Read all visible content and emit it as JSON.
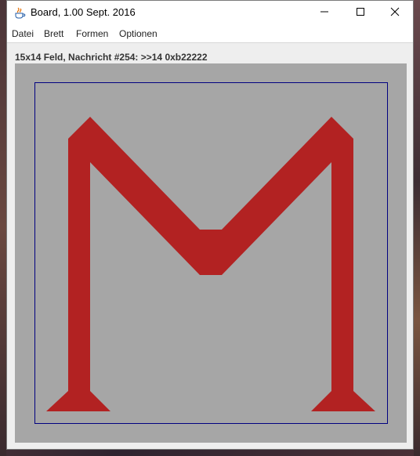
{
  "window": {
    "title": "Board, 1.00 Sept. 2016",
    "icon": "java-coffee-icon",
    "controls": [
      "minimize-icon",
      "maximize-icon",
      "close-icon"
    ]
  },
  "menu": {
    "items": [
      "Datei",
      "Brett",
      "Formen",
      "Optionen"
    ]
  },
  "status": {
    "text": "15x14 Feld, Nachricht #254: >>14 0xb22222"
  },
  "board": {
    "background": "#a6a6a6",
    "frame_color": "#000080",
    "shape_color": "#b22222",
    "shape": "letter-M"
  }
}
